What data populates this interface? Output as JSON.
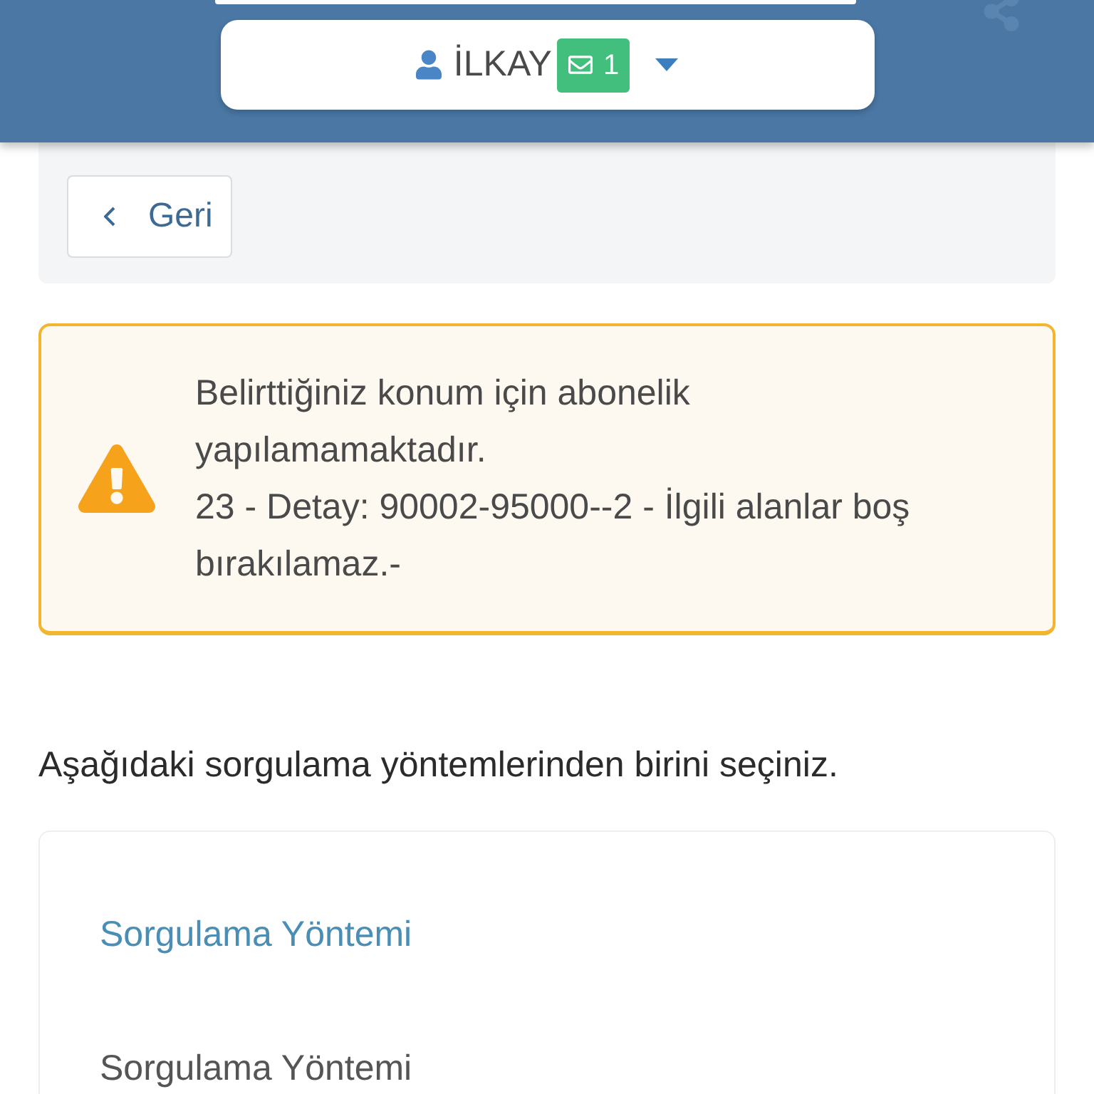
{
  "user_menu": {
    "name": "İLKAY",
    "message_count": "1"
  },
  "back_button": {
    "label": "Geri"
  },
  "alert": {
    "kind": "warning",
    "messages": [
      "Belirttiğiniz konum için abonelik yapılamamaktadır.",
      "23 - Detay: 90002-95000--2 - İlgili alanlar boş bırakılamaz.-"
    ]
  },
  "instruction": "Aşağıdaki sorgulama yöntemlerinden birini seçiniz.",
  "card": {
    "title": "Sorgulama Yöntemi",
    "field_label": "Sorgulama Yöntemi"
  }
}
